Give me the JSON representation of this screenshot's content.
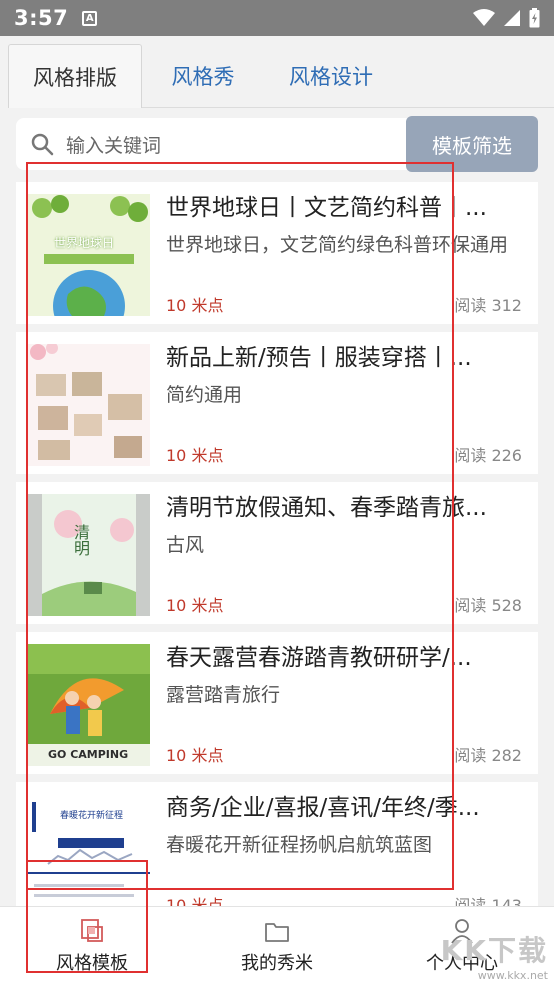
{
  "status": {
    "time": "3:57",
    "notif_icon": "A"
  },
  "tabs": [
    {
      "label": "风格排版",
      "active": true
    },
    {
      "label": "风格秀",
      "active": false
    },
    {
      "label": "风格设计",
      "active": false
    }
  ],
  "search": {
    "placeholder": "输入关键词",
    "filter_label": "模板筛选"
  },
  "items": [
    {
      "title": "世界地球日丨文艺简约科普丨...",
      "desc": "世界地球日，文艺简约绿色科普环保通用",
      "price": "10 米点",
      "reads": "阅读 312",
      "thumb_text": "世界地球日"
    },
    {
      "title": "新品上新/预告丨服装穿搭丨...",
      "desc": "简约通用",
      "price": "10 米点",
      "reads": "阅读 226"
    },
    {
      "title": "清明节放假通知、春季踏青旅...",
      "desc": "古风",
      "price": "10 米点",
      "reads": "阅读 528",
      "thumb_text": "清明"
    },
    {
      "title": "春天露营春游踏青教研研学/...",
      "desc": "露营踏青旅行",
      "price": "10 米点",
      "reads": "阅读 282",
      "thumb_text": "GO CAMPING"
    },
    {
      "title": "商务/企业/喜报/喜讯/年终/季...",
      "desc": "春暖花开新征程扬帆启航筑蓝图",
      "price": "10 米点",
      "reads": "阅读 143",
      "thumb_text": "春暖花开新征程"
    }
  ],
  "bottom_nav": [
    {
      "label": "风格模板",
      "icon": "template-icon"
    },
    {
      "label": "我的秀米",
      "icon": "folder-icon"
    },
    {
      "label": "个人中心",
      "icon": "user-icon"
    }
  ],
  "watermark": {
    "brand": "KK下载",
    "url": "www.kkx.net"
  }
}
